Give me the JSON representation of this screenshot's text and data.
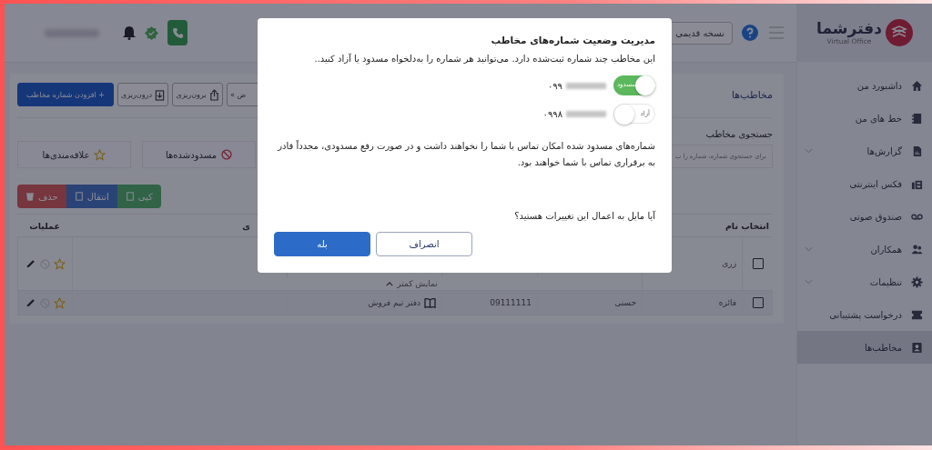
{
  "logo": {
    "name": "دفترشما",
    "subtitle": "Virtual Office"
  },
  "sidebar": {
    "items": [
      {
        "label": "داشبورد من",
        "kind": "home",
        "expandable": false,
        "selected": false
      },
      {
        "label": "خط های من",
        "kind": "lines",
        "expandable": false,
        "selected": false
      },
      {
        "label": "گزارش‌ها",
        "kind": "report",
        "expandable": true,
        "selected": false
      },
      {
        "label": "فکس اینترنتی",
        "kind": "fax",
        "expandable": false,
        "selected": false
      },
      {
        "label": "صندوق صوتی",
        "kind": "voicemail",
        "expandable": false,
        "selected": false
      },
      {
        "label": "همکاران",
        "kind": "people",
        "expandable": true,
        "selected": false
      },
      {
        "label": "تنظیمات",
        "kind": "gear",
        "expandable": true,
        "selected": false
      },
      {
        "label": "درخواست پشتیبانی",
        "kind": "ticket",
        "expandable": false,
        "selected": false
      },
      {
        "label": "مخاطب‌ها",
        "kind": "contact",
        "expandable": false,
        "selected": true
      }
    ]
  },
  "top_bar": {
    "old_version_button": "نسخه قدیمی"
  },
  "page": {
    "title": "مخاطب‌ها",
    "toolbar": [
      {
        "label": "ض »",
        "kind": "plain"
      },
      {
        "label": "برون‌ریزی",
        "kind": "export"
      },
      {
        "label": "درون‌ریزی",
        "kind": "import"
      },
      {
        "label": "+ افزودن شماره مخاطب",
        "kind": "primary"
      }
    ],
    "search": {
      "label": "جستجوی مخاطب",
      "placeholder": "برای جستجوی شماره، شماره را ب"
    },
    "filters": [
      {
        "label": "مسدودشده‌ها",
        "kind": "blocked"
      },
      {
        "label": "علاقه‌مندی‌ها",
        "kind": "favorite"
      }
    ],
    "actions": [
      {
        "label": "کپی",
        "kind": "copy"
      },
      {
        "label": "انتقال",
        "kind": "move"
      },
      {
        "label": "حذف",
        "kind": "delete"
      }
    ]
  },
  "table": {
    "columns": [
      "انتخاب",
      "نام",
      "",
      "",
      "",
      "ی",
      "عملیات"
    ],
    "rows": [
      {
        "checked": false,
        "name": "زری",
        "last_name": "",
        "phone": "",
        "group": "",
        "toggle_label": "نمایش کمتر"
      },
      {
        "checked": false,
        "name": "فائزه",
        "last_name": "حسنی",
        "phone": "09111111",
        "group": "دفتر تیم فروش"
      }
    ]
  },
  "dialog": {
    "title": "مدیریت وضعیت شماره‌های مخاطب",
    "intro": "این مخاطب چند شماره ثبت‌شده دارد. می‌توانید هر شماره را به‌دلخواه مسدود یا آزاد کنید..",
    "numbers": [
      {
        "number": "۰۹۹",
        "blocked": true,
        "state_label": "مسدود"
      },
      {
        "number": "۰۹۹۸",
        "blocked": false,
        "state_label": "آزاد"
      }
    ],
    "note": "شماره‌های مسدود شده امکان تماس با شما را نخواهند داشت و در صورت رفع مسدودی، مجدداً قادر به برقراری تماس با شما خواهند بود.",
    "question": "آیا مایل به اعمال این تغییرات هستید؟",
    "cancel_button": "انصراف",
    "confirm_button": "بله"
  }
}
